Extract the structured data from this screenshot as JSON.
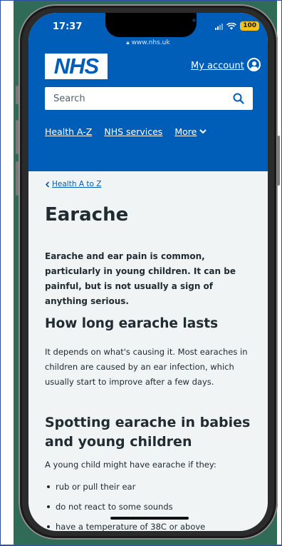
{
  "status_bar": {
    "time": "17:37",
    "battery": "100",
    "url": "www.nhs.uk"
  },
  "header": {
    "logo_text": "NHS",
    "account_label": "My account",
    "search_placeholder": "Search",
    "nav": [
      {
        "label": "Health A-Z"
      },
      {
        "label": "NHS services"
      },
      {
        "label": "More"
      }
    ]
  },
  "breadcrumb": {
    "label": "Health A to Z"
  },
  "page": {
    "title": "Earache",
    "lede": "Earache and ear pain is common, particularly in young children. It can be painful, but is not usually a sign of anything serious.",
    "section1_heading": "How long earache lasts",
    "section1_text": "It depends on what's causing it. Most earaches in children are caused by an ear infection, which usually start to improve after a few days.",
    "section2_heading": "Spotting earache in babies and young children",
    "section2_intro": "A young child might have earache if they:",
    "bullets": [
      "rub or pull their ear",
      "do not react to some sounds",
      "have a temperature of 38C or above"
    ]
  },
  "colors": {
    "nhs_blue": "#005eb8",
    "background": "#f0f4f5",
    "text": "#212b32",
    "battery": "#f2c11c"
  },
  "icons": [
    "search-icon",
    "account-icon",
    "chevron-down-icon",
    "chevron-left-icon",
    "lock-icon",
    "wifi-icon",
    "signal-icon"
  ]
}
